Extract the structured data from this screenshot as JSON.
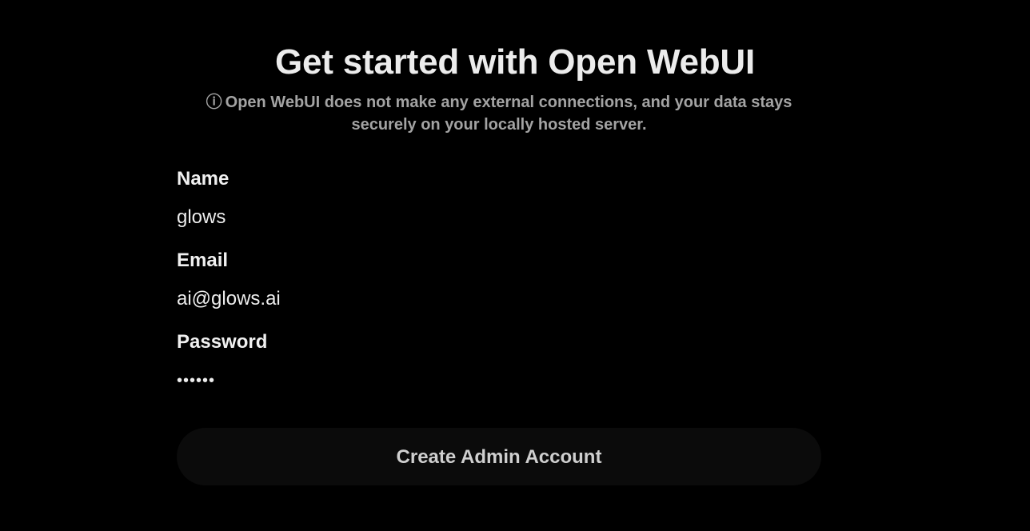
{
  "header": {
    "title": "Get started with Open WebUI",
    "info_icon": "ⓘ",
    "subtitle": "Open WebUI does not make any external connections, and your data stays securely on your locally hosted server."
  },
  "form": {
    "name": {
      "label": "Name",
      "value": "glows"
    },
    "email": {
      "label": "Email",
      "value": "ai@glows.ai"
    },
    "password": {
      "label": "Password",
      "value": "••••••"
    },
    "submit_label": "Create Admin Account"
  },
  "colors": {
    "background": "#000000",
    "text": "#ececec",
    "muted_text": "#a3a3a3",
    "button_bg": "#0b0b0b"
  }
}
